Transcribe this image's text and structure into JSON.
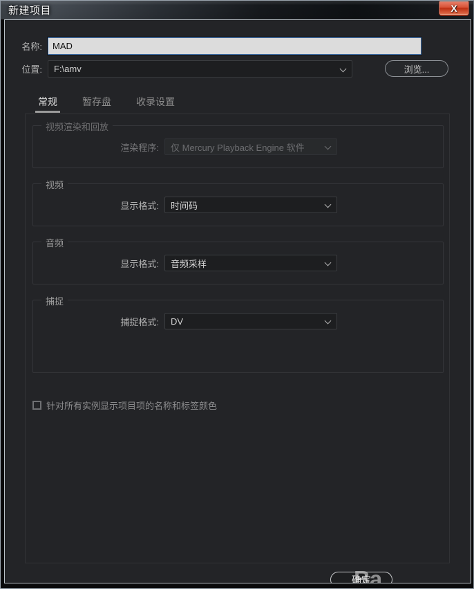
{
  "window": {
    "title": "新建项目",
    "close_glyph": "X"
  },
  "header": {
    "name_label": "名称:",
    "name_value": "MAD",
    "location_label": "位置:",
    "location_value": "F:\\amv",
    "browse_label": "浏览..."
  },
  "tabs": [
    {
      "label": "常规"
    },
    {
      "label": "暂存盘"
    },
    {
      "label": "收录设置"
    }
  ],
  "groups": {
    "render": {
      "legend": "视频渲染和回放",
      "field_label": "渲染程序:",
      "field_value": "仅 Mercury Playback Engine 软件"
    },
    "video": {
      "legend": "视频",
      "field_label": "显示格式:",
      "field_value": "时间码"
    },
    "audio": {
      "legend": "音频",
      "field_label": "显示格式:",
      "field_value": "音频采样"
    },
    "capture": {
      "legend": "捕捉",
      "field_label": "捕捉格式:",
      "field_value": "DV"
    }
  },
  "checkbox": {
    "label": "针对所有实例显示项目项的名称和标签颜色",
    "checked": false
  },
  "footer": {
    "ok_label": "确定"
  },
  "watermark": {
    "text": "Ba"
  },
  "colors": {
    "dialog_bg": "#232427",
    "input_bg": "#dcdcdc",
    "focus_border": "#4a7fbf",
    "close_red": "#d84f33",
    "text_primary": "#d2d2d2",
    "text_muted": "#8b8b8d"
  }
}
